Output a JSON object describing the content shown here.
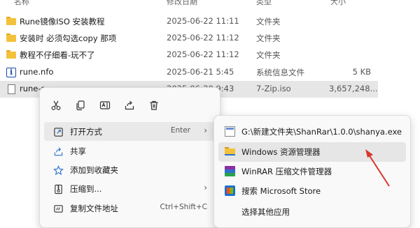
{
  "columns": {
    "name": "名称",
    "date": "修改日期",
    "type": "类型",
    "size": "大小"
  },
  "files": [
    {
      "icon": "folder-icon",
      "name": "Rune镜像ISO 安装教程",
      "date": "2025-06-22 11:11",
      "type": "文件夹",
      "size": ""
    },
    {
      "icon": "folder-icon",
      "name": "安装时 必须勾选copy 那项",
      "date": "2025-06-22 11:12",
      "type": "文件夹",
      "size": ""
    },
    {
      "icon": "folder-icon",
      "name": "教程不仔细看-玩不了",
      "date": "2025-06-22 11:12",
      "type": "文件夹",
      "size": ""
    },
    {
      "icon": "nfo-file-icon",
      "name": "rune.nfo",
      "date": "2025-06-21 5:45",
      "type": "系统信息文件",
      "size": "5 KB"
    },
    {
      "icon": "iso-file-icon",
      "name": "rune-s...",
      "date": "2025-06-20 9:43",
      "type": "7-Zip.iso",
      "size": "3,657,248..."
    }
  ],
  "context_menu": {
    "quick_actions": [
      "cut-icon",
      "copy-icon",
      "rename-icon",
      "share-icon",
      "delete-icon"
    ],
    "items": [
      {
        "icon": "open-with-icon",
        "label": "打开方式",
        "shortcut": "Enter",
        "submenu": true
      },
      {
        "icon": "share-icon",
        "label": "共享",
        "shortcut": "",
        "submenu": false
      },
      {
        "icon": "star-icon",
        "label": "添加到收藏夹",
        "shortcut": "",
        "submenu": false
      },
      {
        "icon": "compress-icon",
        "label": "压缩到...",
        "shortcut": "",
        "submenu": true
      },
      {
        "icon": "copy-path-icon",
        "label": "复制文件地址",
        "shortcut": "Ctrl+Shift+C",
        "submenu": false
      }
    ]
  },
  "open_with_submenu": [
    {
      "icon": "app-icon",
      "label": "G:\\新建文件夹\\ShanRar\\1.0.0\\shanya.exe"
    },
    {
      "icon": "explorer-icon",
      "label": "Windows 资源管理器"
    },
    {
      "icon": "winrar-icon",
      "label": "WinRAR 压缩文件管理器"
    },
    {
      "icon": "store-icon",
      "label": "搜索 Microsoft Store"
    },
    {
      "icon": "",
      "label": "选择其他应用"
    }
  ],
  "colors": {
    "arrow": "#d9362b",
    "selection": "#e6e6e6",
    "folder": "#f3c13a"
  }
}
